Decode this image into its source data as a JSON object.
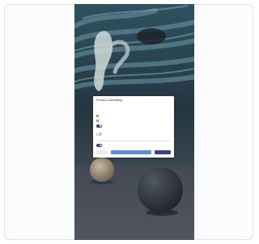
{
  "colors": {
    "page_background": "#ffffff",
    "card_border": "#dfe3ea",
    "dialog_background": "#ffffff",
    "accent_primary": "#403f8e",
    "accent_secondary": "#5a8fd6"
  },
  "dialog": {
    "title": "Privacy & Advertising",
    "body_text": "",
    "options": [
      {
        "label": "",
        "checked": false
      },
      {
        "label": "",
        "checked": false
      }
    ],
    "toggles": [
      {
        "label": "",
        "on": true,
        "sublabel": ""
      },
      {
        "label": "",
        "on": false,
        "sublabel": ""
      },
      {
        "label": "",
        "on": true,
        "sublabel": ""
      }
    ],
    "buttons": [
      {
        "label": ""
      },
      {
        "label": ""
      },
      {
        "label": ""
      }
    ]
  }
}
